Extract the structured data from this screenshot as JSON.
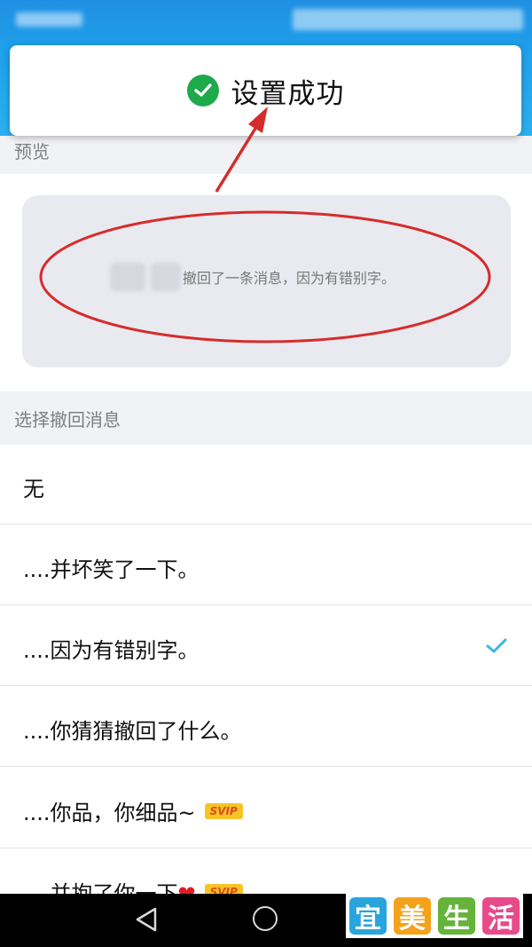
{
  "toast": {
    "text": "设置成功",
    "icon": "check-circle-icon",
    "icon_color": "#1ea94b"
  },
  "preview": {
    "section_title": "预览",
    "message_text": "撤回了一条消息，因为有错别字。"
  },
  "recall": {
    "section_title": "选择撤回消息",
    "items": [
      {
        "label": "无"
      },
      {
        "label": "....并坏笑了一下。"
      },
      {
        "label": "....因为有错别字。",
        "selected": true
      },
      {
        "label": "....你猜猜撤回了什么。"
      },
      {
        "label": "....你品，你细品~",
        "badge": "SVIP"
      },
      {
        "label": "....并抱了你一下",
        "badge": "SVIP",
        "emoji": "❤"
      }
    ]
  },
  "watermark": {
    "chars": [
      "宜",
      "美",
      "生",
      "活"
    ],
    "colors": [
      "#2aa4dc",
      "#f4a21b",
      "#65b33a",
      "#e84a8a"
    ]
  },
  "colors": {
    "accent_check": "#3ab6e6",
    "annotation_red": "#d62c2c"
  }
}
